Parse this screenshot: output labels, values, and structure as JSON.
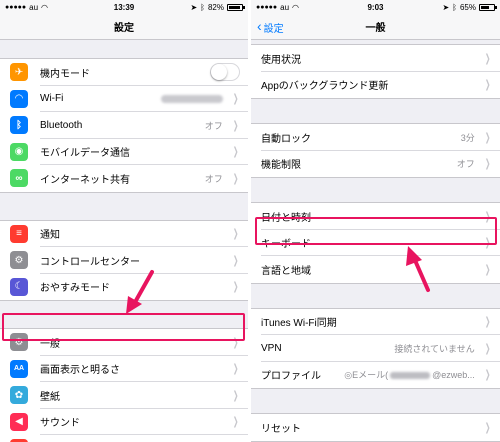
{
  "accent_color": "#007aff",
  "highlight_color": "#e8145f",
  "left": {
    "status": {
      "carrier": "au",
      "time": "13:39",
      "battery": "82%",
      "battery_level": 0.82
    },
    "title": "設定",
    "groups": [
      [
        {
          "label": "機内モード",
          "icon": "airplane-icon",
          "color": "#ff9500",
          "glyph": "✈",
          "control": "toggle"
        },
        {
          "label": "Wi-Fi",
          "icon": "wifi-icon",
          "color": "#007aff",
          "glyph": "◠",
          "value_blurred": true
        },
        {
          "label": "Bluetooth",
          "icon": "bluetooth-icon",
          "color": "#007aff",
          "glyph": "ᛒ",
          "value": "オフ"
        },
        {
          "label": "モバイルデータ通信",
          "icon": "cellular-icon",
          "color": "#4cd964",
          "glyph": "◉",
          "value": ""
        },
        {
          "label": "インターネット共有",
          "icon": "hotspot-icon",
          "color": "#4cd964",
          "glyph": "∞",
          "value": "オフ"
        }
      ],
      [
        {
          "label": "通知",
          "icon": "notifications-icon",
          "color": "#ff3b30",
          "glyph": "≡",
          "value": ""
        },
        {
          "label": "コントロールセンター",
          "icon": "control-center-icon",
          "color": "#8e8e93",
          "glyph": "⚙",
          "value": ""
        },
        {
          "label": "おやすみモード",
          "icon": "moon-icon",
          "color": "#5856d6",
          "glyph": "☾",
          "value": ""
        }
      ],
      [
        {
          "label": "一般",
          "icon": "gear-icon",
          "color": "#8e8e93",
          "glyph": "⚙",
          "value": ""
        },
        {
          "label": "画面表示と明るさ",
          "icon": "display-brightness-icon",
          "color": "#007aff",
          "glyph": "AA",
          "value": ""
        },
        {
          "label": "壁紙",
          "icon": "wallpaper-icon",
          "color": "#34aadc",
          "glyph": "✿",
          "value": ""
        },
        {
          "label": "サウンド",
          "icon": "sound-icon",
          "color": "#ff2d55",
          "glyph": "◀",
          "value": ""
        },
        {
          "label": "Touch IDとパスコード",
          "icon": "touch-id-icon",
          "color": "#ff3b30",
          "glyph": "◎",
          "value": ""
        }
      ]
    ]
  },
  "right": {
    "status": {
      "carrier": "au",
      "time": "9:03",
      "battery": "65%",
      "battery_level": 0.65
    },
    "title": "一般",
    "back_label": "設定",
    "groups": [
      [
        {
          "label": "使用状況",
          "value": ""
        },
        {
          "label": "Appのバックグラウンド更新",
          "value": ""
        }
      ],
      [
        {
          "label": "自動ロック",
          "value": "3分"
        },
        {
          "label": "機能制限",
          "value": "オフ"
        }
      ],
      [
        {
          "label": "日付と時刻",
          "value": ""
        },
        {
          "label": "キーボード",
          "value": ""
        },
        {
          "label": "言語と地域",
          "value": ""
        }
      ],
      [
        {
          "label": "iTunes Wi-Fi同期",
          "value": ""
        },
        {
          "label": "VPN",
          "value": "接続されていません"
        },
        {
          "label": "プロファイル",
          "value_prefix": "◎Eメール(",
          "value_suffix": "@ezweb...",
          "value_blurred_middle": true
        }
      ],
      [
        {
          "label": "リセット",
          "value": ""
        }
      ]
    ]
  }
}
